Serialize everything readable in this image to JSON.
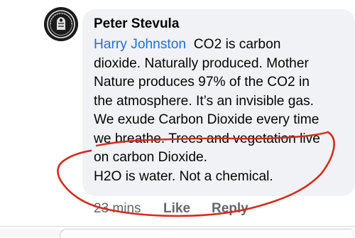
{
  "comment": {
    "author": "Peter Stevula",
    "mention": "Harry Johnston",
    "lines": [
      "CO2 is carbon",
      "dioxide. Naturally produced. Mother",
      "Nature produces 97% of the CO2 in",
      "the atmosphere. It’s an invisible gas.",
      "We exude Carbon Dioxide every time",
      "we breathe. Trees and vegetation live",
      "on carbon Dioxide.",
      "H2O is water. Not a chemical."
    ]
  },
  "actions": {
    "time": "23 mins",
    "like": "Like",
    "reply": "Reply"
  },
  "annotation": {
    "ink_color": "#d42b1e"
  },
  "icons": {
    "avatar": "profile-picture"
  }
}
